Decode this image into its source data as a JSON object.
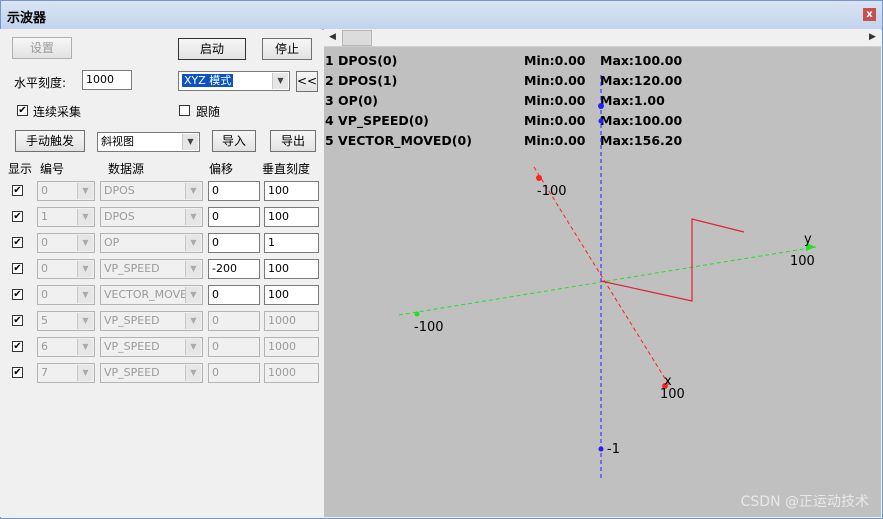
{
  "window": {
    "title": "示波器",
    "close_label": "x"
  },
  "toolbar": {
    "settings_label": "设置",
    "start_label": "启动",
    "stop_label": "停止",
    "hscale_label": "水平刻度:",
    "hscale_value": "1000",
    "mode_value": "XYZ 模式",
    "collapse_label": "<<",
    "continuous_label": "连续采集",
    "continuous_checked": true,
    "follow_label": "跟随",
    "follow_checked": false,
    "manual_trigger_label": "手动触发",
    "view_value": "斜视图",
    "import_label": "导入",
    "export_label": "导出"
  },
  "table": {
    "headers": {
      "show": "显示",
      "index": "编号",
      "source": "数据源",
      "offset": "偏移",
      "vscale": "垂直刻度"
    },
    "rows": [
      {
        "checked": true,
        "index": "0",
        "source": "DPOS",
        "offset": "0",
        "vscale": "100",
        "enabled": true
      },
      {
        "checked": true,
        "index": "1",
        "source": "DPOS",
        "offset": "0",
        "vscale": "100",
        "enabled": true
      },
      {
        "checked": true,
        "index": "0",
        "source": "OP",
        "offset": "0",
        "vscale": "1",
        "enabled": true
      },
      {
        "checked": true,
        "index": "0",
        "source": "VP_SPEED",
        "offset": "-200",
        "vscale": "100",
        "enabled": true
      },
      {
        "checked": true,
        "index": "0",
        "source": "VECTOR_MOVED",
        "offset": "0",
        "vscale": "100",
        "enabled": true
      },
      {
        "checked": true,
        "index": "5",
        "source": "VP_SPEED",
        "offset": "0",
        "vscale": "1000",
        "enabled": false
      },
      {
        "checked": true,
        "index": "6",
        "source": "VP_SPEED",
        "offset": "0",
        "vscale": "1000",
        "enabled": false
      },
      {
        "checked": true,
        "index": "7",
        "source": "VP_SPEED",
        "offset": "0",
        "vscale": "1000",
        "enabled": false
      }
    ]
  },
  "legend": [
    {
      "name": "1 DPOS(0)",
      "min": "Min:0.00",
      "max": "Max:100.00"
    },
    {
      "name": "2 DPOS(1)",
      "min": "Min:0.00",
      "max": "Max:120.00"
    },
    {
      "name": "3 OP(0)",
      "min": "Min:0.00",
      "max": "Max:1.00"
    },
    {
      "name": "4 VP_SPEED(0)",
      "min": "Min:0.00",
      "max": "Max:100.00"
    },
    {
      "name": "5 VECTOR_MOVED(0)",
      "min": "Min:0.00",
      "max": "Max:156.20"
    }
  ],
  "plot": {
    "x_axis_label": "x",
    "y_axis_label": "y",
    "x_pos_tick": "100",
    "x_neg_tick": "-100",
    "y_pos_tick": "100",
    "y_neg_tick": "-100",
    "z_neg_tick": "-1",
    "colors": {
      "x_axis": "#ff2020",
      "y_axis": "#22e022",
      "z_axis": "#2020ff",
      "trace": "#e0203a",
      "background": "#c0c0c0"
    }
  },
  "watermark": "CSDN @正运动技术"
}
